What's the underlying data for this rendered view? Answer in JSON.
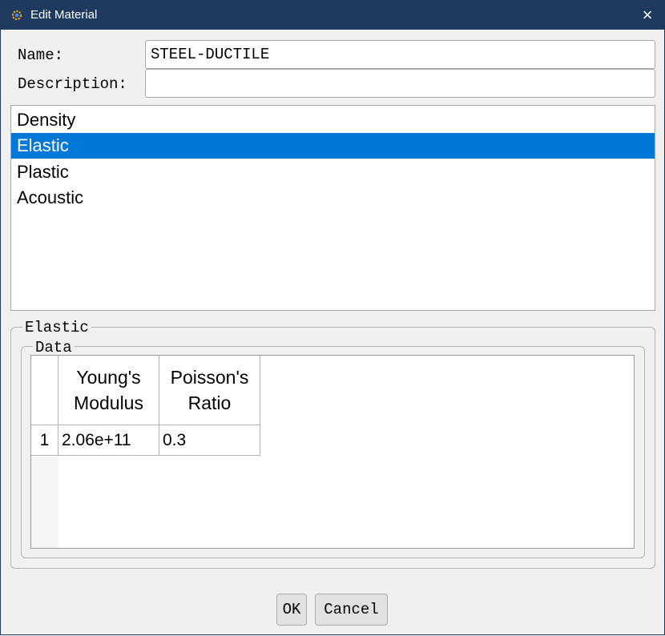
{
  "window": {
    "title": "Edit Material",
    "close_glyph": "×",
    "app_icon": "gear-icon"
  },
  "form": {
    "name_label": "Name:",
    "name_value": "STEEL-DUCTILE",
    "description_label": "Description:",
    "description_value": ""
  },
  "properties": {
    "items": [
      {
        "label": "Density"
      },
      {
        "label": "Elastic"
      },
      {
        "label": "Plastic"
      },
      {
        "label": "Acoustic"
      }
    ],
    "selected": "Elastic"
  },
  "elastic_group": {
    "title": "Elastic",
    "data_group_title": "Data",
    "table": {
      "columns": [
        {
          "line1": "Young's",
          "line2": "Modulus"
        },
        {
          "line1": "Poisson's",
          "line2": "Ratio"
        }
      ],
      "rows": [
        {
          "num": "1",
          "cells": [
            "2.06e+11",
            "0.3"
          ]
        }
      ]
    }
  },
  "buttons": {
    "ok": "OK",
    "cancel": "Cancel"
  },
  "colors": {
    "titlebar": "#1e3a5f",
    "selection": "#0078d7"
  }
}
